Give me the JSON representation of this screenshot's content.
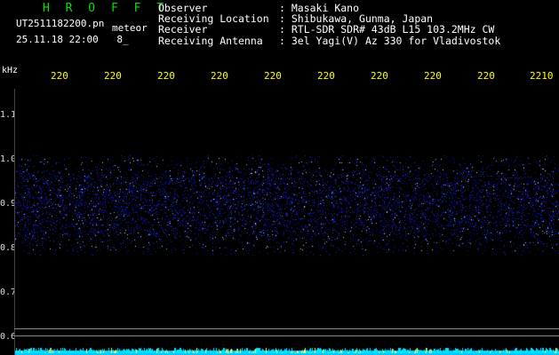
{
  "header": {
    "title": "H R O F F T",
    "file_name": "UT2511182200.pn",
    "file_suffix": "meteor",
    "datetime": "25.11.18 22:00",
    "datetime_extra": "8_",
    "fields": [
      {
        "label": "Observer",
        "value": "Masaki Kano"
      },
      {
        "label": "Receiving Location",
        "value": "Shibukawa, Gunma, Japan"
      },
      {
        "label": "Receiver",
        "value": "RTL-SDR SDR# 43dB L15 103.2MHz CW"
      },
      {
        "label": "Receiving Antenna",
        "value": "3el Yagi(V) Az 330 for Vladivostok"
      }
    ]
  },
  "axis": {
    "unit": "kHz",
    "time_ticks": [
      "220",
      "220",
      "220",
      "220",
      "220",
      "220",
      "220",
      "220",
      "220",
      "2210"
    ],
    "freq_ticks": [
      "1.1",
      "1.0",
      "0.9",
      "0.8",
      "0.7",
      "0.6"
    ]
  },
  "colors": {
    "background": "#000000",
    "noise_band": "#1a2aff",
    "bottom_strip": "#00e5ff",
    "tick_text": "#ffff00",
    "title_green": "#00e000"
  }
}
